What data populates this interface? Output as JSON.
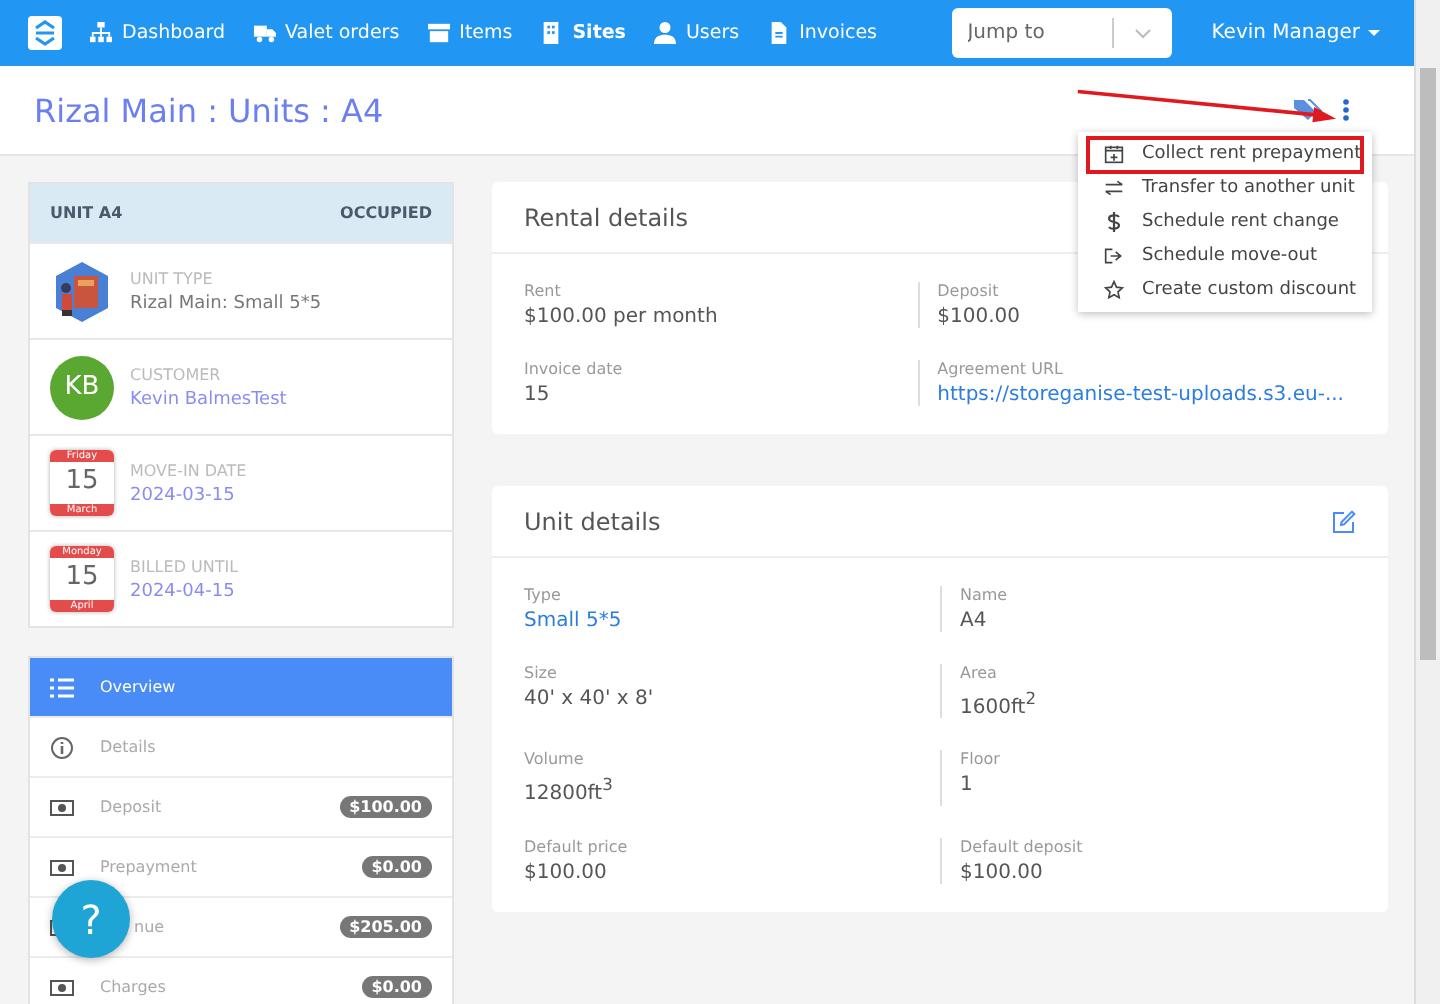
{
  "nav": {
    "items": [
      {
        "label": "Dashboard",
        "selected": false
      },
      {
        "label": "Valet orders",
        "selected": false
      },
      {
        "label": "Items",
        "selected": false
      },
      {
        "label": "Sites",
        "selected": true
      },
      {
        "label": "Users",
        "selected": false
      },
      {
        "label": "Invoices",
        "selected": false
      }
    ],
    "jump_to": {
      "placeholder": "Jump to"
    },
    "user": "Kevin Manager"
  },
  "header": {
    "title": "Rizal Main : Units : A4"
  },
  "menu": {
    "items": [
      {
        "label": "Collect rent prepayment",
        "highlighted": true
      },
      {
        "label": "Transfer to another unit",
        "highlighted": false
      },
      {
        "label": "Schedule rent change",
        "highlighted": false
      },
      {
        "label": "Schedule move-out",
        "highlighted": false
      },
      {
        "label": "Create custom discount",
        "highlighted": false
      }
    ]
  },
  "unit_card": {
    "title": "UNIT A4",
    "status": "OCCUPIED",
    "rows": [
      {
        "kind": "picture",
        "label": "UNIT TYPE",
        "value": "Rizal Main: Small 5*5",
        "link": false
      },
      {
        "kind": "avatar",
        "initials": "KB",
        "color": "#5aa832",
        "label": "CUSTOMER",
        "value": "Kevin BalmesTest",
        "link": true
      },
      {
        "kind": "calendar",
        "weekday": "Friday",
        "day": "15",
        "month": "March",
        "label": "MOVE-IN DATE",
        "value": "2024-03-15",
        "link": true
      },
      {
        "kind": "calendar",
        "weekday": "Monday",
        "day": "15",
        "month": "April",
        "label": "BILLED UNTIL",
        "value": "2024-04-15",
        "link": true
      }
    ]
  },
  "side_nav": {
    "items": [
      {
        "label": "Overview",
        "selected": true
      },
      {
        "label": "Details",
        "selected": false
      },
      {
        "label": "Deposit",
        "selected": false,
        "badge": "$100.00"
      },
      {
        "label": "Prepayment",
        "selected": false,
        "badge": "$0.00"
      },
      {
        "label": "nue",
        "selected": false,
        "badge": "$205.00"
      },
      {
        "label": "Charges",
        "selected": false,
        "badge": "$0.00"
      }
    ]
  },
  "rental_details": {
    "title": "Rental details",
    "fields": [
      {
        "label": "Rent",
        "value": "$100.00 per month",
        "link": false
      },
      {
        "label": "Deposit",
        "value": "$100.00",
        "link": false
      },
      {
        "label": "Invoice date",
        "value": "15",
        "link": false
      },
      {
        "label": "Agreement URL",
        "value": "https://storeganise-test-uploads.s3.eu-...",
        "link": true
      }
    ]
  },
  "unit_details": {
    "title": "Unit details",
    "fields": [
      {
        "label": "Type",
        "value": "Small 5*5",
        "link": true
      },
      {
        "label": "Name",
        "value": "A4",
        "link": false
      },
      {
        "label": "Size",
        "value": "40' x 40' x 8'",
        "link": false
      },
      {
        "label": "Area",
        "value": "1600ft$^{2}$",
        "link": false
      },
      {
        "label": "Volume",
        "value": "12800ft$^{3}$",
        "link": false
      },
      {
        "label": "Floor",
        "value": "1",
        "link": false
      },
      {
        "label": "Default price",
        "value": "$100.00",
        "link": false
      },
      {
        "label": "Default deposit",
        "value": "$100.00",
        "link": false
      }
    ]
  },
  "help": {
    "label": "?"
  }
}
